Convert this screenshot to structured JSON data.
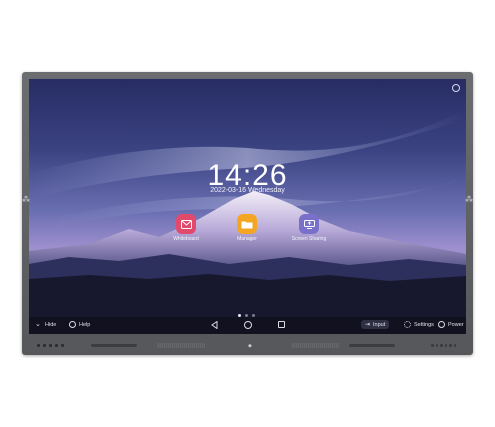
{
  "home": {
    "time": "14:26",
    "date": "2022-03-16 Wednesday"
  },
  "apps": [
    {
      "label": "Whiteboard",
      "icon": "whiteboard-icon",
      "color": "#e24a6c"
    },
    {
      "label": "Manager",
      "icon": "folder-icon",
      "color": "#f4a623"
    },
    {
      "label": "Screen Sharing",
      "icon": "screen-share-icon",
      "color": "#7a6fc9"
    }
  ],
  "taskbar": {
    "hide_label": "Hide",
    "help_label": "Help",
    "input_label": "Input",
    "settings_label": "Settings",
    "power_label": "Power"
  },
  "page_indicator": {
    "pages": 3,
    "current": 1
  }
}
